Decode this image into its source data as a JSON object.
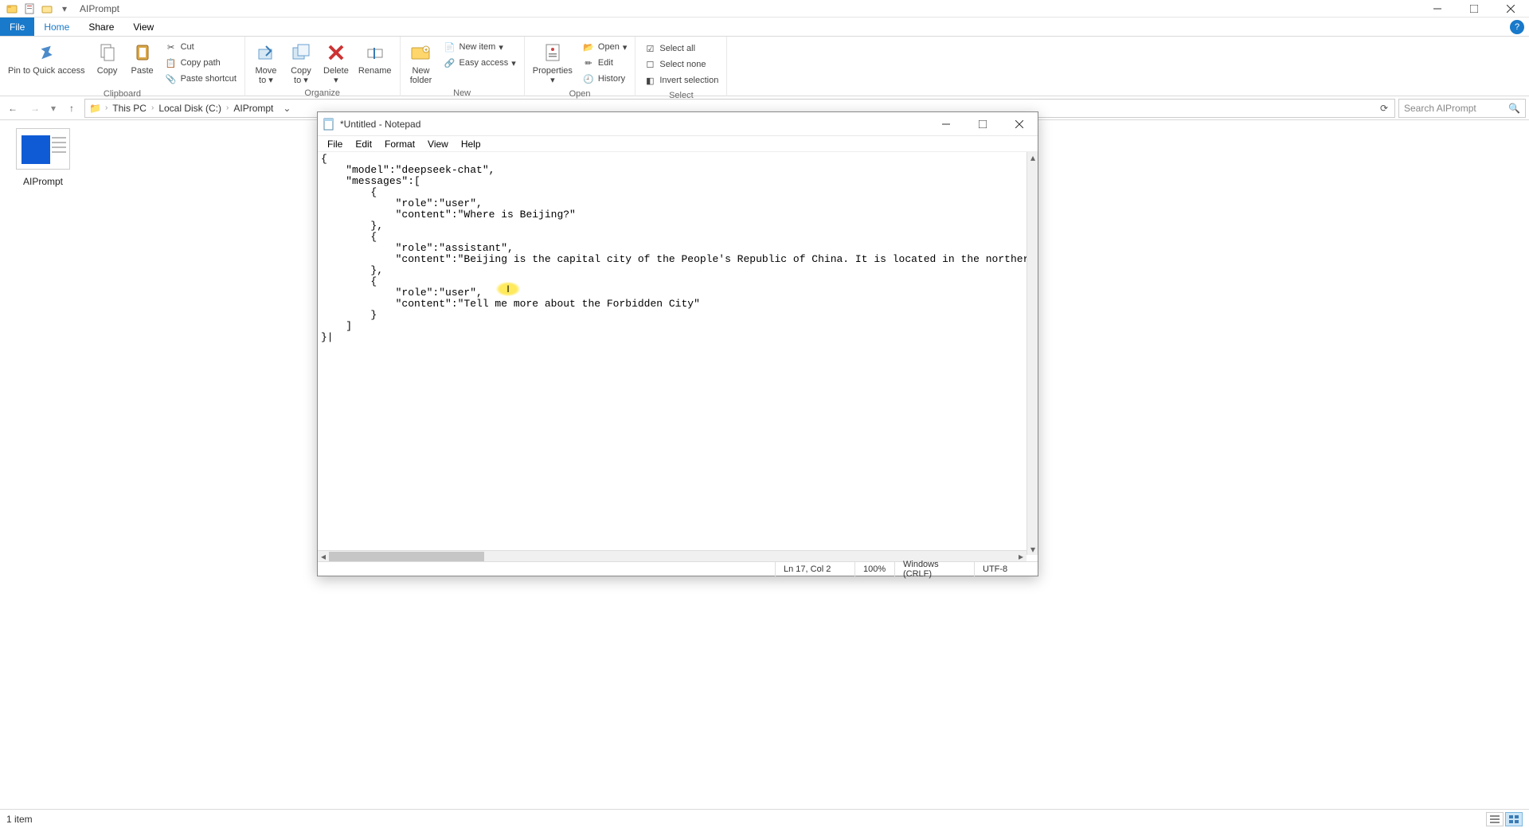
{
  "explorer": {
    "title": "AIPrompt",
    "tabs": {
      "file": "File",
      "home": "Home",
      "share": "Share",
      "view": "View"
    },
    "ribbon": {
      "group_clipboard": "Clipboard",
      "group_organize": "Organize",
      "group_new": "New",
      "group_open": "Open",
      "group_select": "Select",
      "pin": "Pin to Quick access",
      "copy": "Copy",
      "paste": "Paste",
      "cut": "Cut",
      "copy_path": "Copy path",
      "paste_shortcut": "Paste shortcut",
      "move_to": "Move to",
      "copy_to": "Copy to",
      "delete": "Delete",
      "rename": "Rename",
      "new_folder": "New folder",
      "new_item": "New item",
      "easy_access": "Easy access",
      "properties": "Properties",
      "open": "Open",
      "edit": "Edit",
      "history": "History",
      "select_all": "Select all",
      "select_none": "Select none",
      "invert": "Invert selection"
    },
    "crumbs": {
      "thispc": "This PC",
      "c": "Local Disk (C:)",
      "folder": "AIPrompt"
    },
    "search_placeholder": "Search AIPrompt",
    "file_name": "AIPrompt",
    "status": "1 item"
  },
  "notepad": {
    "title": "*Untitled - Notepad",
    "menu": {
      "file": "File",
      "edit": "Edit",
      "format": "Format",
      "view": "View",
      "help": "Help"
    },
    "content": "{\n    \"model\":\"deepseek-chat\",\n    \"messages\":[\n        {\n            \"role\":\"user\",\n            \"content\":\"Where is Beijing?\"\n        },\n        {\n            \"role\":\"assistant\",\n            \"content\":\"Beijing is the capital city of the People's Republic of China. It is located in the northern part of the country, near the\n        },\n        {\n            \"role\":\"user\",\n            \"content\":\"Tell me more about the Forbidden City\"\n        }\n    ]\n}|",
    "status": {
      "pos": "Ln 17, Col 2",
      "zoom": "100%",
      "eol": "Windows (CRLF)",
      "enc": "UTF-8"
    },
    "cursor_char": "I"
  }
}
